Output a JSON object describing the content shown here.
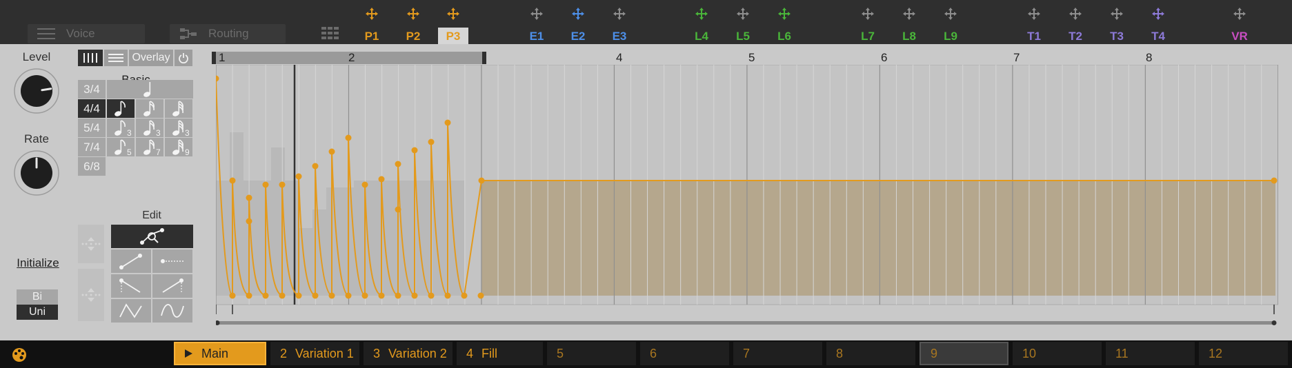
{
  "nav": {
    "voice_label": "Voice",
    "routing_label": "Routing"
  },
  "modulators": [
    {
      "id": "P1",
      "color": "#e39a1d",
      "selected": false
    },
    {
      "id": "P2",
      "color": "#e39a1d",
      "selected": false
    },
    {
      "id": "P3",
      "color": "#e39a1d",
      "selected": true
    },
    {
      "id": "E1",
      "color": "#4d8fe8",
      "selected": false
    },
    {
      "id": "E2",
      "color": "#4d8fe8",
      "selected": false
    },
    {
      "id": "E3",
      "color": "#4d8fe8",
      "selected": false
    },
    {
      "id": "L4",
      "color": "#4ab53a",
      "selected": false
    },
    {
      "id": "L5",
      "color": "#4ab53a",
      "selected": false
    },
    {
      "id": "L6",
      "color": "#4ab53a",
      "selected": false
    },
    {
      "id": "L7",
      "color": "#4ab53a",
      "selected": false
    },
    {
      "id": "L8",
      "color": "#4ab53a",
      "selected": false
    },
    {
      "id": "L9",
      "color": "#4ab53a",
      "selected": false
    },
    {
      "id": "T1",
      "color": "#8d7ad8",
      "selected": false
    },
    {
      "id": "T2",
      "color": "#8d7ad8",
      "selected": false
    },
    {
      "id": "T3",
      "color": "#8d7ad8",
      "selected": false
    },
    {
      "id": "T4",
      "color": "#8d7ad8",
      "selected": false
    },
    {
      "id": "VR",
      "color": "#c94ec2",
      "selected": false
    }
  ],
  "controls": {
    "level_label": "Level",
    "level_value": 0.8,
    "rate_label": "Rate",
    "rate_value": 0.5,
    "overlay_label": "Overlay",
    "basic_label": "Basic",
    "time_signatures": [
      "3/4",
      "4/4",
      "5/4",
      "7/4",
      "6/8"
    ],
    "selected_time_signature": "4/4",
    "triplet_marks": [
      "3",
      "3",
      "3"
    ],
    "quint_marks": [
      "5",
      "7",
      "9"
    ],
    "edit_label": "Edit",
    "initialize_label": "Initialize",
    "polarity_options": [
      "Bi",
      "Uni"
    ],
    "selected_polarity": "Uni"
  },
  "ruler": {
    "bars": [
      "1",
      "2",
      "4",
      "5",
      "6",
      "7",
      "8"
    ]
  },
  "chart_data": {
    "type": "area",
    "title": "",
    "xlim": [
      0,
      16
    ],
    "ylim": [
      0,
      1
    ],
    "loop_region": [
      0,
      1
    ]
  },
  "clips": [
    {
      "num": "",
      "name": "Main",
      "active": true
    },
    {
      "num": "2",
      "name": "Variation 1"
    },
    {
      "num": "3",
      "name": "Variation 2"
    },
    {
      "num": "4",
      "name": "Fill"
    },
    {
      "num": "5",
      "name": ""
    },
    {
      "num": "6",
      "name": ""
    },
    {
      "num": "7",
      "name": ""
    },
    {
      "num": "8",
      "name": ""
    },
    {
      "num": "9",
      "name": ""
    },
    {
      "num": "10",
      "name": ""
    },
    {
      "num": "11",
      "name": ""
    },
    {
      "num": "12",
      "name": ""
    }
  ]
}
